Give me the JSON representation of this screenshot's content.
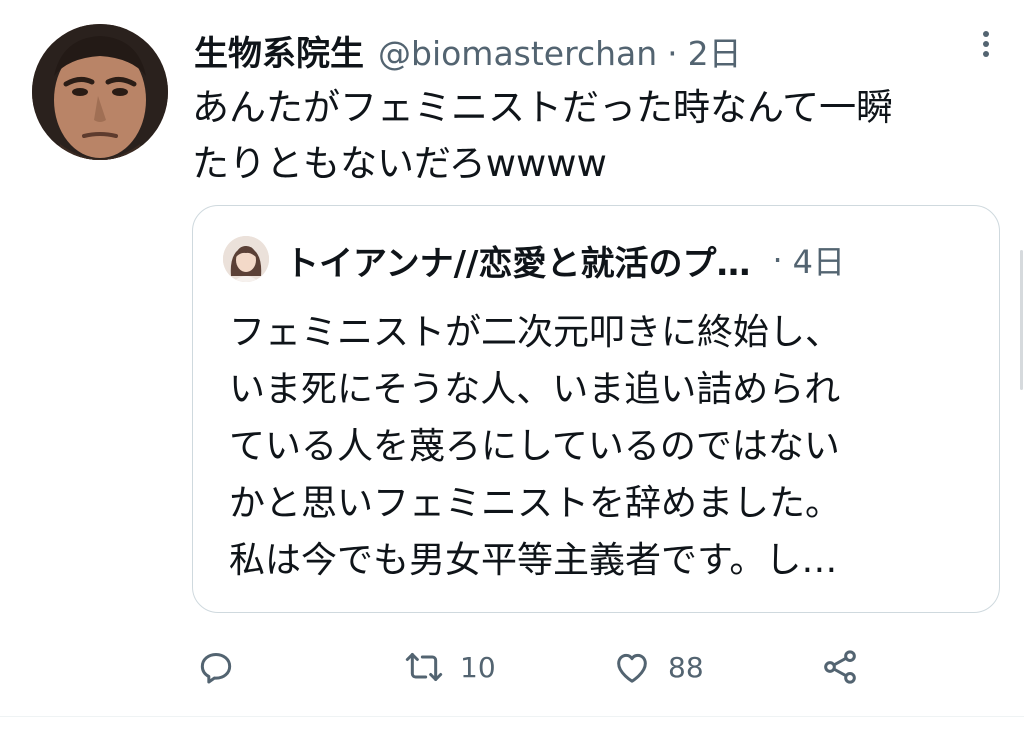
{
  "tweet": {
    "author": {
      "display_name": "生物系院生",
      "handle": "@biomasterchan"
    },
    "separator": "·",
    "time": "2日",
    "text_lines": [
      "あんたがフェミニストだった時なんて一瞬",
      "たりともないだろwwww"
    ],
    "quoted": {
      "display_name": "トイアンナ//恋愛と就活のプ…",
      "separator": "·",
      "time": "4日",
      "text_lines": [
        "フェミニストが二次元叩きに終始し、",
        "いま死にそうな人、いま追い詰められ",
        "ている人を蔑ろにしているのではない",
        "かと思いフェミニストを辞めました。",
        "私は今でも男女平等主義者です。し…"
      ]
    },
    "actions": {
      "reply": {
        "icon": "reply-icon",
        "count": ""
      },
      "retweet": {
        "icon": "retweet-icon",
        "count": "10"
      },
      "like": {
        "icon": "heart-icon",
        "count": "88"
      },
      "share": {
        "icon": "share-icon"
      }
    }
  },
  "colors": {
    "text_primary": "#0f1419",
    "text_secondary": "#536471",
    "border": "#cfd9de",
    "background": "#ffffff"
  }
}
